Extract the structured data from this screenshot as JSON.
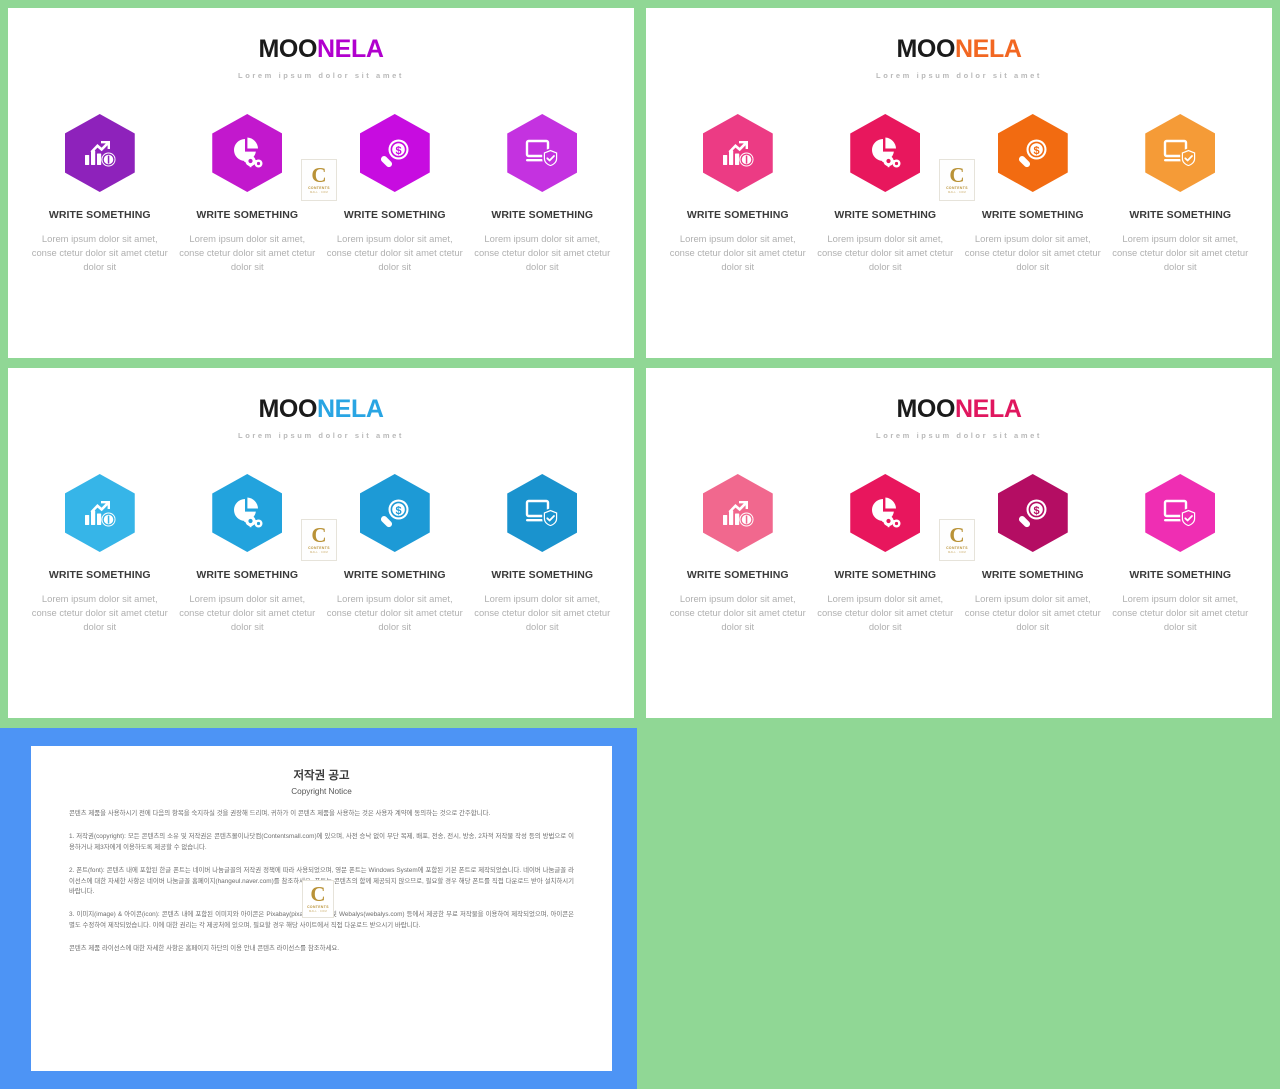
{
  "background_color": "#90d795",
  "slides": [
    {
      "id": "slide-1",
      "logo": {
        "dark_part": "MOO",
        "accent_part": "NELA",
        "accent_color": "#b100ce",
        "tagline": "Lorem ipsum dolor sit amet"
      },
      "columns": [
        {
          "icon": "bar-chart-growth-icon",
          "color": "#8e22bb",
          "title": "WRITE SOMETHING",
          "body": "Lorem ipsum dolor sit amet, conse ctetur dolor sit amet ctetur dolor sit"
        },
        {
          "icon": "pie-chart-gears-icon",
          "color": "#c218cd",
          "title": "WRITE SOMETHING",
          "body": "Lorem ipsum dolor sit amet, conse ctetur dolor sit amet ctetur dolor sit"
        },
        {
          "icon": "magnifier-dollar-icon",
          "color": "#c70ce0",
          "title": "WRITE SOMETHING",
          "body": "Lorem ipsum dolor sit amet, conse ctetur dolor sit amet ctetur dolor sit"
        },
        {
          "icon": "monitor-shield-icon",
          "color": "#c432e0",
          "title": "WRITE SOMETHING",
          "body": "Lorem ipsum dolor sit amet, conse ctetur dolor sit amet ctetur dolor sit"
        }
      ]
    },
    {
      "id": "slide-2",
      "logo": {
        "dark_part": "MOO",
        "accent_part": "NELA",
        "accent_color": "#f26722",
        "tagline": "Lorem ipsum dolor sit amet"
      },
      "columns": [
        {
          "icon": "bar-chart-growth-icon",
          "color": "#ec3b84",
          "title": "WRITE SOMETHING",
          "body": "Lorem ipsum dolor sit amet, conse ctetur dolor sit amet ctetur dolor sit"
        },
        {
          "icon": "pie-chart-gears-icon",
          "color": "#e8175d",
          "title": "WRITE SOMETHING",
          "body": "Lorem ipsum dolor sit amet, conse ctetur dolor sit amet ctetur dolor sit"
        },
        {
          "icon": "magnifier-dollar-icon",
          "color": "#f26b11",
          "title": "WRITE SOMETHING",
          "body": "Lorem ipsum dolor sit amet, conse ctetur dolor sit amet ctetur dolor sit"
        },
        {
          "icon": "monitor-shield-icon",
          "color": "#f59b37",
          "title": "WRITE SOMETHING",
          "body": "Lorem ipsum dolor sit amet, conse ctetur dolor sit amet ctetur dolor sit"
        }
      ]
    },
    {
      "id": "slide-3",
      "logo": {
        "dark_part": "MOO",
        "accent_part": "NELA",
        "accent_color": "#29a5e3",
        "tagline": "Lorem ipsum dolor sit amet"
      },
      "columns": [
        {
          "icon": "bar-chart-growth-icon",
          "color": "#36b5e8",
          "title": "WRITE SOMETHING",
          "body": "Lorem ipsum dolor sit amet, conse ctetur dolor sit amet ctetur dolor sit"
        },
        {
          "icon": "pie-chart-gears-icon",
          "color": "#22a3dd",
          "title": "WRITE SOMETHING",
          "body": "Lorem ipsum dolor sit amet, conse ctetur dolor sit amet ctetur dolor sit"
        },
        {
          "icon": "magnifier-dollar-icon",
          "color": "#1d9ad6",
          "title": "WRITE SOMETHING",
          "body": "Lorem ipsum dolor sit amet, conse ctetur dolor sit amet ctetur dolor sit"
        },
        {
          "icon": "monitor-shield-icon",
          "color": "#1a93ce",
          "title": "WRITE SOMETHING",
          "body": "Lorem ipsum dolor sit amet, conse ctetur dolor sit amet ctetur dolor sit"
        }
      ]
    },
    {
      "id": "slide-4",
      "logo": {
        "dark_part": "MOO",
        "accent_part": "NELA",
        "accent_color": "#e0175f",
        "tagline": "Lorem ipsum dolor sit amet"
      },
      "columns": [
        {
          "icon": "bar-chart-growth-icon",
          "color": "#f1688e",
          "title": "WRITE SOMETHING",
          "body": "Lorem ipsum dolor sit amet, conse ctetur dolor sit amet ctetur dolor sit"
        },
        {
          "icon": "pie-chart-gears-icon",
          "color": "#e8165d",
          "title": "WRITE SOMETHING",
          "body": "Lorem ipsum dolor sit amet, conse ctetur dolor sit amet ctetur dolor sit"
        },
        {
          "icon": "magnifier-dollar-icon",
          "color": "#b40d63",
          "title": "WRITE SOMETHING",
          "body": "Lorem ipsum dolor sit amet, conse ctetur dolor sit amet ctetur dolor sit"
        },
        {
          "icon": "monitor-shield-icon",
          "color": "#ef2eb3",
          "title": "WRITE SOMETHING",
          "body": "Lorem ipsum dolor sit amet, conse ctetur dolor sit amet ctetur dolor sit"
        }
      ]
    }
  ],
  "watermark": {
    "letter": "C",
    "line1": "CONTENTS",
    "line2": "MALL . COM",
    "color": "#b99237"
  },
  "copyright_doc": {
    "frame_color": "#4d94f5",
    "title": "저작권 공고",
    "subtitle": "Copyright Notice",
    "paragraphs": [
      "콘텐츠 제품을 사용하시기 전에 다음의 항목을 숙지하실 것을 권장해 드리며, 귀하가 이 콘텐츠 제품을 사용하는 것은 사용자 계약에 동의하는 것으로 간주합니다.",
      "1. 저작권(copyright): 모든 콘텐츠의 소유 및 저작권은 콘텐츠몰이나닷컴(Contentsmall.com)에 있으며, 사전 승낙 없이 무단 복제, 배포, 전송, 전시, 방송, 2차적 저작물 작성 등의 방법으로 이용하거나 제3자에게 이용하도록 제공할 수 없습니다.",
      "2. 폰트(font): 콘텐츠 내에 포함된 한글 폰트는 네이버 나눔글꼴의 저작권 정책에 따라 사용되었으며, 영문 폰트는 Windows System에 포함된 기본 폰트로 제작되었습니다. 네이버 나눔글꼴 라이선스에 대한 자세한 사항은 네이버 나눔글꼴 홈페이지(hangeul.naver.com)를 참조하세요. 폰트는 콘텐츠의 함께 제공되지 않으므로, 필요할 경우 해당 폰트를 직접 다운로드 받아 설치하시기 바랍니다.",
      "3. 이미지(image) & 아이콘(icon): 콘텐츠 내에 포함된 이미지와 아이콘은 Pixabay(pixabay.com) 및 Webalys(webalys.com) 등에서 제공한 무료 저작물을 이용하여 제작되었으며, 아이콘은 별도 수정하여 제작되었습니다. 이에 대한 권리는 각 제공처에 있으며, 필요할 경우 해당 사이트에서 직접 다운로드 받으시기 바랍니다.",
      "콘텐츠 제품 라이선스에 대한 자세한 사항은 홈페이지 하단의 이용 안내 콘텐츠 라이선스를 참조하세요."
    ]
  }
}
